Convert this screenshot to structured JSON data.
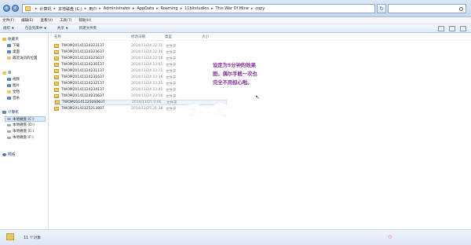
{
  "address": {
    "breadcrumbs": [
      "计算机",
      "本地磁盘 (C:)",
      "用户",
      "Administrator",
      "AppData",
      "Roaming",
      "11bitstudios",
      "This War Of Mine",
      "copy"
    ]
  },
  "menu": [
    "文件(F)",
    "编辑(E)",
    "查看(V)",
    "工具(T)",
    "帮助(H)"
  ],
  "toolbar": {
    "organize": "组织",
    "include_library": "包含到库中",
    "share": "共享",
    "new_folder": "新建文件夹"
  },
  "sidebar": {
    "favorites": "收藏夹",
    "favorites_items": [
      "下载",
      "桌面",
      "最近访问的位置"
    ],
    "libraries": "库",
    "library_items": [
      "视频",
      "图片",
      "文档",
      "音乐"
    ],
    "computer": "计算机",
    "computer_items": [
      "本地磁盘 (C:)",
      "本地磁盘 (D:)",
      "本地磁盘 (E:)",
      "本地磁盘 (F:)"
    ],
    "network": "网络"
  },
  "columns": {
    "name": "名称",
    "date": "修改日期",
    "type": "类型",
    "size": "大小"
  },
  "files": [
    {
      "name": "TWOM20141124223137",
      "date": "2014/11/24 22:31",
      "type": "文件夹"
    },
    {
      "name": "TWOM20141124223637",
      "date": "2014/11/24 22:36",
      "type": "文件夹"
    },
    {
      "name": "TWOM20141124225637",
      "date": "2014/11/24 22:56",
      "type": "文件夹"
    },
    {
      "name": "TWOM20141124230137",
      "date": "2014/11/24 23:01",
      "type": "文件夹"
    },
    {
      "name": "TWOM20141124231137",
      "date": "2014/11/24 23:11",
      "type": "文件夹"
    },
    {
      "name": "TWOM20141124231637",
      "date": "2014/11/24 23:16",
      "type": "文件夹"
    },
    {
      "name": "TWOM20141124232137",
      "date": "2014/11/24 23:21",
      "type": "文件夹"
    },
    {
      "name": "TWOM20141124234137",
      "date": "2014/11/24 23:41",
      "type": "文件夹"
    },
    {
      "name": "TWOM20141124235637",
      "date": "2014/11/24 23:56",
      "type": "文件夹"
    },
    {
      "name": "TWOM20141125000637",
      "date": "2014/11/25 0:06",
      "type": "文件夹"
    },
    {
      "name": "TWOM20141125213807",
      "date": "2014/11/25 21:38",
      "type": "文件夹"
    }
  ],
  "annotation": [
    "设定为5分钟的效果",
    "图，偶尔手贱一次也",
    "完全不用担心啦。"
  ],
  "status": "11 个对象"
}
